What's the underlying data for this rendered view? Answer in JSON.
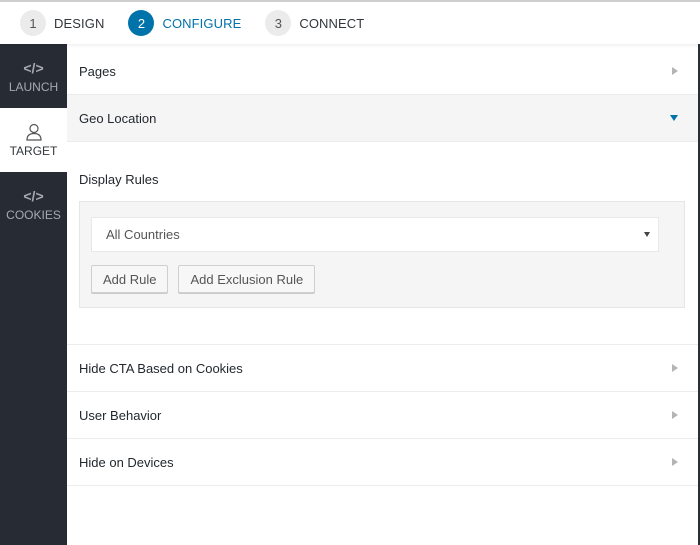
{
  "steps": [
    {
      "number": "1",
      "label": "DESIGN",
      "active": false
    },
    {
      "number": "2",
      "label": "CONFIGURE",
      "active": true
    },
    {
      "number": "3",
      "label": "CONNECT",
      "active": false
    }
  ],
  "sidebar": {
    "items": [
      {
        "label": "LAUNCH",
        "icon": "code-icon",
        "glyph": "</>",
        "active": false
      },
      {
        "label": "TARGET",
        "icon": "user-icon",
        "active": true
      },
      {
        "label": "COOKIES",
        "icon": "code-icon",
        "glyph": "</>",
        "active": false
      }
    ]
  },
  "sections": {
    "pages": {
      "title": "Pages"
    },
    "geo": {
      "title": "Geo Location",
      "display_rules_title": "Display Rules",
      "country_select_value": "All Countries",
      "add_rule_label": "Add Rule",
      "add_exclusion_rule_label": "Add Exclusion Rule"
    },
    "hide_cta": {
      "title": "Hide CTA Based on Cookies"
    },
    "user_behavior": {
      "title": "User Behavior"
    },
    "hide_devices": {
      "title": "Hide on Devices"
    }
  },
  "colors": {
    "accent": "#0073aa",
    "sidebar_bg": "#272b33",
    "open_section_bg": "#f5f5f5"
  }
}
